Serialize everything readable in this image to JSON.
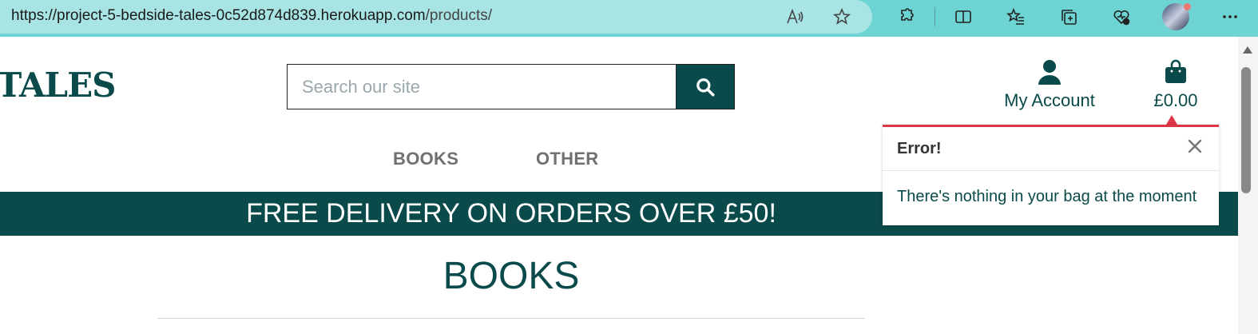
{
  "browser": {
    "url_host": "https://project-5-bedside-tales-0c52d874d839.herokuapp.com",
    "url_path": "/products/",
    "icons": [
      "read-aloud-icon",
      "favorite-star-icon",
      "extensions-icon",
      "split-screen-icon",
      "favorites-icon",
      "collections-icon",
      "browser-essentials-icon",
      "profile-avatar",
      "more-icon"
    ]
  },
  "header": {
    "logo_text": "TALES",
    "search_placeholder": "Search our site",
    "account_label": "My Account",
    "bag_total": "£0.00"
  },
  "nav": {
    "items": [
      {
        "label": "BOOKS"
      },
      {
        "label": "OTHER"
      }
    ]
  },
  "banner": {
    "text": "FREE DELIVERY ON ORDERS OVER £50!"
  },
  "main": {
    "heading": "BOOKS"
  },
  "toast": {
    "title": "Error!",
    "message": "There's nothing in your bag at the moment",
    "accent_color": "#dc3545"
  },
  "colors": {
    "brand": "#0a4a4a",
    "chrome": "#6dd3d3"
  }
}
